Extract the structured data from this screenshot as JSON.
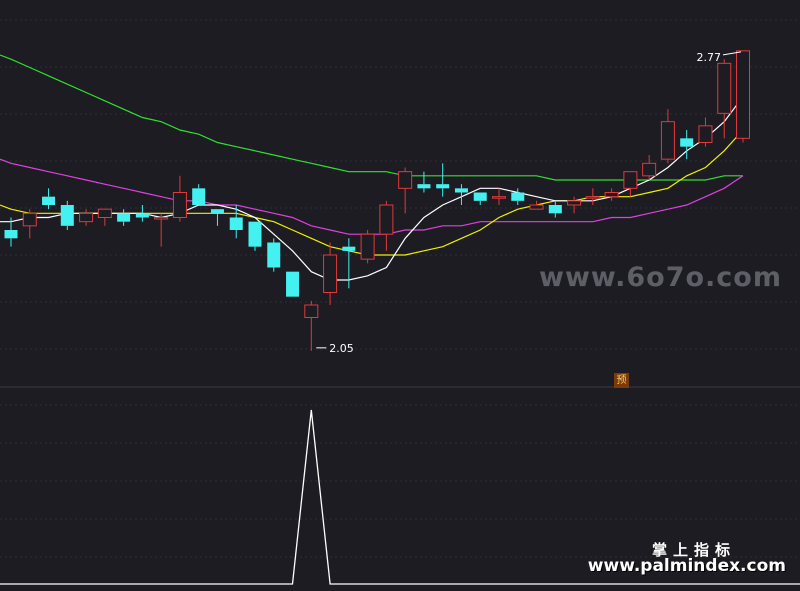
{
  "chart_data": [
    {
      "type": "candlestick",
      "annotations": {
        "high_label": "2.77",
        "low_label": "2.05",
        "badge": "预"
      },
      "colors": {
        "up": "#e03a3a",
        "down": "#44f0f0",
        "ma5": "#ffffff",
        "ma10": "#f0f000",
        "ma20": "#e040e0",
        "ma60": "#30e030",
        "grid": "#2e2e38"
      },
      "candles": [
        {
          "o": 2.34,
          "h": 2.37,
          "l": 2.3,
          "c": 2.32
        },
        {
          "o": 2.35,
          "h": 2.39,
          "l": 2.32,
          "c": 2.38
        },
        {
          "o": 2.42,
          "h": 2.44,
          "l": 2.39,
          "c": 2.4
        },
        {
          "o": 2.4,
          "h": 2.41,
          "l": 2.34,
          "c": 2.35
        },
        {
          "o": 2.36,
          "h": 2.39,
          "l": 2.35,
          "c": 2.38
        },
        {
          "o": 2.37,
          "h": 2.39,
          "l": 2.35,
          "c": 2.39
        },
        {
          "o": 2.38,
          "h": 2.39,
          "l": 2.35,
          "c": 2.36
        },
        {
          "o": 2.38,
          "h": 2.4,
          "l": 2.36,
          "c": 2.37
        },
        {
          "o": 2.37,
          "h": 2.38,
          "l": 2.3,
          "c": 2.37
        },
        {
          "o": 2.37,
          "h": 2.47,
          "l": 2.36,
          "c": 2.43
        },
        {
          "o": 2.44,
          "h": 2.45,
          "l": 2.4,
          "c": 2.4
        },
        {
          "o": 2.39,
          "h": 2.39,
          "l": 2.35,
          "c": 2.38
        },
        {
          "o": 2.37,
          "h": 2.4,
          "l": 2.32,
          "c": 2.34
        },
        {
          "o": 2.36,
          "h": 2.36,
          "l": 2.29,
          "c": 2.3
        },
        {
          "o": 2.31,
          "h": 2.32,
          "l": 2.24,
          "c": 2.25
        },
        {
          "o": 2.24,
          "h": 2.24,
          "l": 2.18,
          "c": 2.18
        },
        {
          "o": 2.13,
          "h": 2.17,
          "l": 2.05,
          "c": 2.16
        },
        {
          "o": 2.19,
          "h": 2.31,
          "l": 2.16,
          "c": 2.28
        },
        {
          "o": 2.3,
          "h": 2.32,
          "l": 2.2,
          "c": 2.29
        },
        {
          "o": 2.27,
          "h": 2.34,
          "l": 2.26,
          "c": 2.33
        },
        {
          "o": 2.33,
          "h": 2.41,
          "l": 2.29,
          "c": 2.4
        },
        {
          "o": 2.44,
          "h": 2.49,
          "l": 2.38,
          "c": 2.48
        },
        {
          "o": 2.45,
          "h": 2.48,
          "l": 2.43,
          "c": 2.44
        },
        {
          "o": 2.45,
          "h": 2.5,
          "l": 2.42,
          "c": 2.44
        },
        {
          "o": 2.44,
          "h": 2.45,
          "l": 2.4,
          "c": 2.43
        },
        {
          "o": 2.43,
          "h": 2.43,
          "l": 2.4,
          "c": 2.41
        },
        {
          "o": 2.42,
          "h": 2.44,
          "l": 2.4,
          "c": 2.42
        },
        {
          "o": 2.43,
          "h": 2.44,
          "l": 2.4,
          "c": 2.41
        },
        {
          "o": 2.39,
          "h": 2.41,
          "l": 2.39,
          "c": 2.4
        },
        {
          "o": 2.4,
          "h": 2.41,
          "l": 2.37,
          "c": 2.38
        },
        {
          "o": 2.4,
          "h": 2.42,
          "l": 2.38,
          "c": 2.41
        },
        {
          "o": 2.42,
          "h": 2.44,
          "l": 2.4,
          "c": 2.42
        },
        {
          "o": 2.42,
          "h": 2.44,
          "l": 2.41,
          "c": 2.43
        },
        {
          "o": 2.44,
          "h": 2.47,
          "l": 2.42,
          "c": 2.48
        },
        {
          "o": 2.47,
          "h": 2.52,
          "l": 2.46,
          "c": 2.5
        },
        {
          "o": 2.51,
          "h": 2.63,
          "l": 2.5,
          "c": 2.6
        },
        {
          "o": 2.56,
          "h": 2.58,
          "l": 2.51,
          "c": 2.54
        },
        {
          "o": 2.55,
          "h": 2.61,
          "l": 2.54,
          "c": 2.59
        },
        {
          "o": 2.62,
          "h": 2.75,
          "l": 2.56,
          "c": 2.74
        },
        {
          "o": 2.56,
          "h": 2.77,
          "l": 2.55,
          "c": 2.77
        }
      ],
      "moving_averages": {
        "ma5": [
          2.36,
          2.37,
          2.37,
          2.38,
          2.38,
          2.38,
          2.38,
          2.38,
          2.37,
          2.38,
          2.4,
          2.4,
          2.39,
          2.37,
          2.33,
          2.29,
          2.24,
          2.22,
          2.22,
          2.23,
          2.25,
          2.32,
          2.37,
          2.4,
          2.42,
          2.44,
          2.44,
          2.43,
          2.42,
          2.41,
          2.41,
          2.41,
          2.42,
          2.44,
          2.46,
          2.49,
          2.53,
          2.56,
          2.6,
          2.66
        ],
        "ma10": [
          2.39,
          2.38,
          2.38,
          2.38,
          2.38,
          2.38,
          2.38,
          2.38,
          2.38,
          2.38,
          2.38,
          2.38,
          2.38,
          2.37,
          2.36,
          2.34,
          2.32,
          2.3,
          2.29,
          2.28,
          2.28,
          2.28,
          2.29,
          2.3,
          2.32,
          2.34,
          2.37,
          2.39,
          2.4,
          2.41,
          2.41,
          2.42,
          2.42,
          2.42,
          2.43,
          2.44,
          2.47,
          2.49,
          2.53,
          2.58
        ],
        "ma20": [
          2.5,
          2.49,
          2.48,
          2.47,
          2.46,
          2.45,
          2.44,
          2.43,
          2.42,
          2.41,
          2.41,
          2.4,
          2.4,
          2.39,
          2.38,
          2.37,
          2.35,
          2.34,
          2.33,
          2.33,
          2.33,
          2.34,
          2.34,
          2.35,
          2.35,
          2.36,
          2.36,
          2.36,
          2.36,
          2.36,
          2.36,
          2.36,
          2.37,
          2.37,
          2.38,
          2.39,
          2.4,
          2.42,
          2.44,
          2.47
        ],
        "ma60": [
          2.75,
          2.73,
          2.71,
          2.69,
          2.67,
          2.65,
          2.63,
          2.61,
          2.6,
          2.58,
          2.57,
          2.55,
          2.54,
          2.53,
          2.52,
          2.51,
          2.5,
          2.49,
          2.48,
          2.48,
          2.48,
          2.47,
          2.47,
          2.47,
          2.47,
          2.47,
          2.47,
          2.47,
          2.47,
          2.46,
          2.46,
          2.46,
          2.46,
          2.46,
          2.46,
          2.46,
          2.46,
          2.46,
          2.47,
          2.47
        ]
      },
      "ylim": [
        1.98,
        2.82
      ]
    },
    {
      "type": "line",
      "color": "#ffffff",
      "values": [
        0,
        0,
        0,
        0,
        0,
        0,
        0,
        0,
        0,
        0,
        0,
        0,
        0,
        0,
        0,
        0,
        1,
        0,
        0,
        0,
        0,
        0,
        0,
        0,
        0,
        0,
        0,
        0,
        0,
        0,
        0,
        0,
        0,
        0,
        0,
        0,
        0,
        0,
        0,
        0
      ],
      "ylim": [
        0,
        1
      ]
    }
  ],
  "watermarks": {
    "top": "www.6o7o.com",
    "brand_cn": "掌上指标",
    "brand_url": "www.palmindex.com"
  }
}
